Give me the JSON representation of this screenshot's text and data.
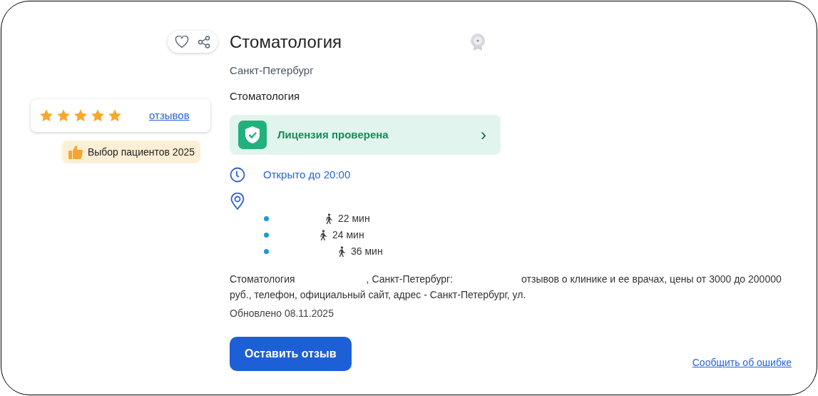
{
  "actions": {
    "favorite": false
  },
  "rating": {
    "stars": 5,
    "reviews_link": "отзывов"
  },
  "badge": "Выбор пациентов 2025",
  "title": "Стоматология",
  "city": "Санкт-Петербург",
  "category": "Стоматология",
  "license": {
    "label": "Лицензия проверена",
    "chevron": "›"
  },
  "hours": "Открыто до 20:00",
  "transit": [
    {
      "time": "22 мин"
    },
    {
      "time": "24 мин"
    },
    {
      "time": "36 мин"
    }
  ],
  "description": [
    "Стоматология",
    ", Санкт-Петербург:",
    "отзывов о клинике и ее врачах, цены от 3000 до 200000 руб., телефон, официальный сайт, адрес - Санкт-Петербург, ул."
  ],
  "updated": "Обновлено 08.11.2025",
  "review_button": "Оставить отзыв",
  "report_link": "Сообщить об ошибке"
}
